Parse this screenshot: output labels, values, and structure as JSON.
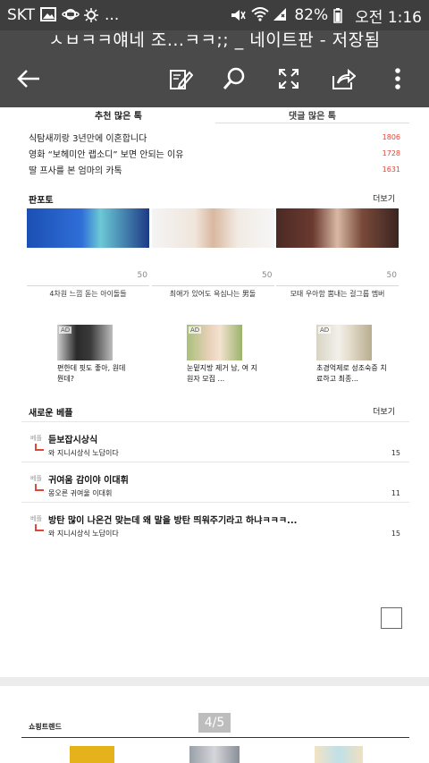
{
  "status": {
    "carrier": "SKT",
    "dots": "...",
    "battery": "82%",
    "time": "오전 1:16"
  },
  "window": {
    "title": "ㅅㅂㅋㅋ얘네 조...ㅋㅋ;; _ 네이트판 - 저장됨"
  },
  "toolbar": {
    "icons": [
      "back-arrow-icon",
      "edit-note-icon",
      "search-icon",
      "fullscreen-icon",
      "share-icon",
      "more-vert-icon"
    ]
  },
  "tabs": {
    "recommend": "추천 많은 톡",
    "comments": "댓글 많은 톡"
  },
  "ranking": [
    {
      "title": "식탐새끼랑 3년만에 이혼합니다",
      "count": "1806"
    },
    {
      "title": "영화 “보헤미안 랩소디” 보면 안되는 이유",
      "count": "1728"
    },
    {
      "title": "딸 프사를 본 엄마의 카톡",
      "count": "1631"
    }
  ],
  "pannphoto": {
    "title": "판포토",
    "more": "더보기",
    "items": [
      {
        "count": "50",
        "caption": "4차원 느낌 돋는 아이돌들"
      },
      {
        "count": "50",
        "caption": "최애가 있어도 욕심나는 男돌"
      },
      {
        "count": "50",
        "caption": "모태 우아함 뿜내는 걸그룹 멤버"
      }
    ]
  },
  "ads": [
    {
      "badge": "AD",
      "caption": "편한데 핏도 좋아, 원데 뭔데?"
    },
    {
      "badge": "AD",
      "caption": "눈밑지방 제거 남, 여 지원자 모집 ..."
    },
    {
      "badge": "AD",
      "caption": "초경억제로 성조숙증 치료하고 최종..."
    }
  ],
  "newbest": {
    "title": "새로운 베플",
    "more": "더보기",
    "items": [
      {
        "tag": "베플",
        "title": "듣보잡시상식",
        "sub": "와 지니시상식 노답이다",
        "count": "15"
      },
      {
        "tag": "베플",
        "title": "귀여움 감이야 이대휘",
        "sub": "몽오른 귀여울 이대휘",
        "count": "11"
      },
      {
        "tag": "베플",
        "title": "방탄 많이 나온건 맞는데 왜 말을 방탄 띄워주기라고 하냐ㅋㅋㅋ...",
        "sub": "와 지니시상식 노답이다",
        "count": "15"
      }
    ]
  },
  "shopping": {
    "title": "쇼핑트렌드"
  },
  "pager": {
    "label": "4/5"
  },
  "colors": {
    "topbar": "#4a4a4a",
    "statusbar": "#3e3e3e",
    "accent_red": "#e2453c"
  }
}
